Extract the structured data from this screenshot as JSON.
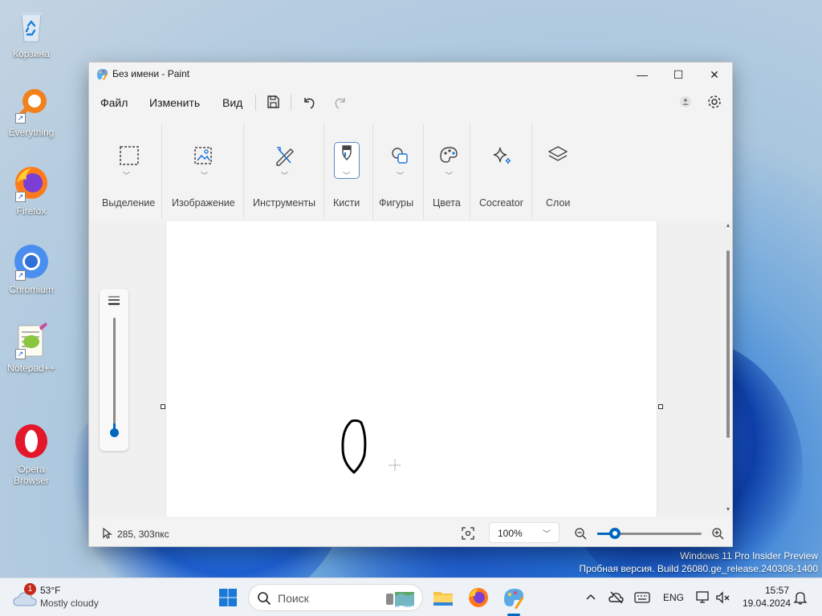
{
  "desktop": {
    "icons": [
      {
        "label": "Корзина"
      },
      {
        "label": "Everything"
      },
      {
        "label": "Firefox"
      },
      {
        "label": "Chromium"
      },
      {
        "label": "Notepad++"
      },
      {
        "label": "Opera\nBrowser"
      }
    ],
    "watermark": {
      "line1": "Windows 11 Pro Insider Preview",
      "line2": "Пробная версия. Build 26080.ge_release.240308-1400"
    }
  },
  "window": {
    "title": "Без имени - Paint",
    "controls": {
      "minimize": "—",
      "maximize": "☐",
      "close": "✕"
    },
    "menu": {
      "file": "Файл",
      "edit": "Изменить",
      "view": "Вид"
    },
    "ribbon": {
      "groups": [
        {
          "label": "Выделение"
        },
        {
          "label": "Изображение"
        },
        {
          "label": "Инструменты"
        },
        {
          "label": "Кисти"
        },
        {
          "label": "Фигуры"
        },
        {
          "label": "Цвета"
        },
        {
          "label": "Cocreator"
        },
        {
          "label": "Слои"
        }
      ],
      "active_group": "Кисти"
    },
    "brush_size_level": 0.06,
    "status": {
      "coords": "285, 303пкс",
      "zoom": "100%",
      "zoom_level_fraction": 0.15
    }
  },
  "taskbar": {
    "weather": {
      "badge": "1",
      "temp": "53°F",
      "desc": "Mostly cloudy"
    },
    "search_placeholder": "Поиск",
    "tray": {
      "lang": "ENG",
      "time": "15:57",
      "date": "19.04.2024"
    }
  },
  "colors": {
    "accent": "#0067c0",
    "window_bg": "#f3f3f3",
    "canvas": "#ffffff"
  }
}
